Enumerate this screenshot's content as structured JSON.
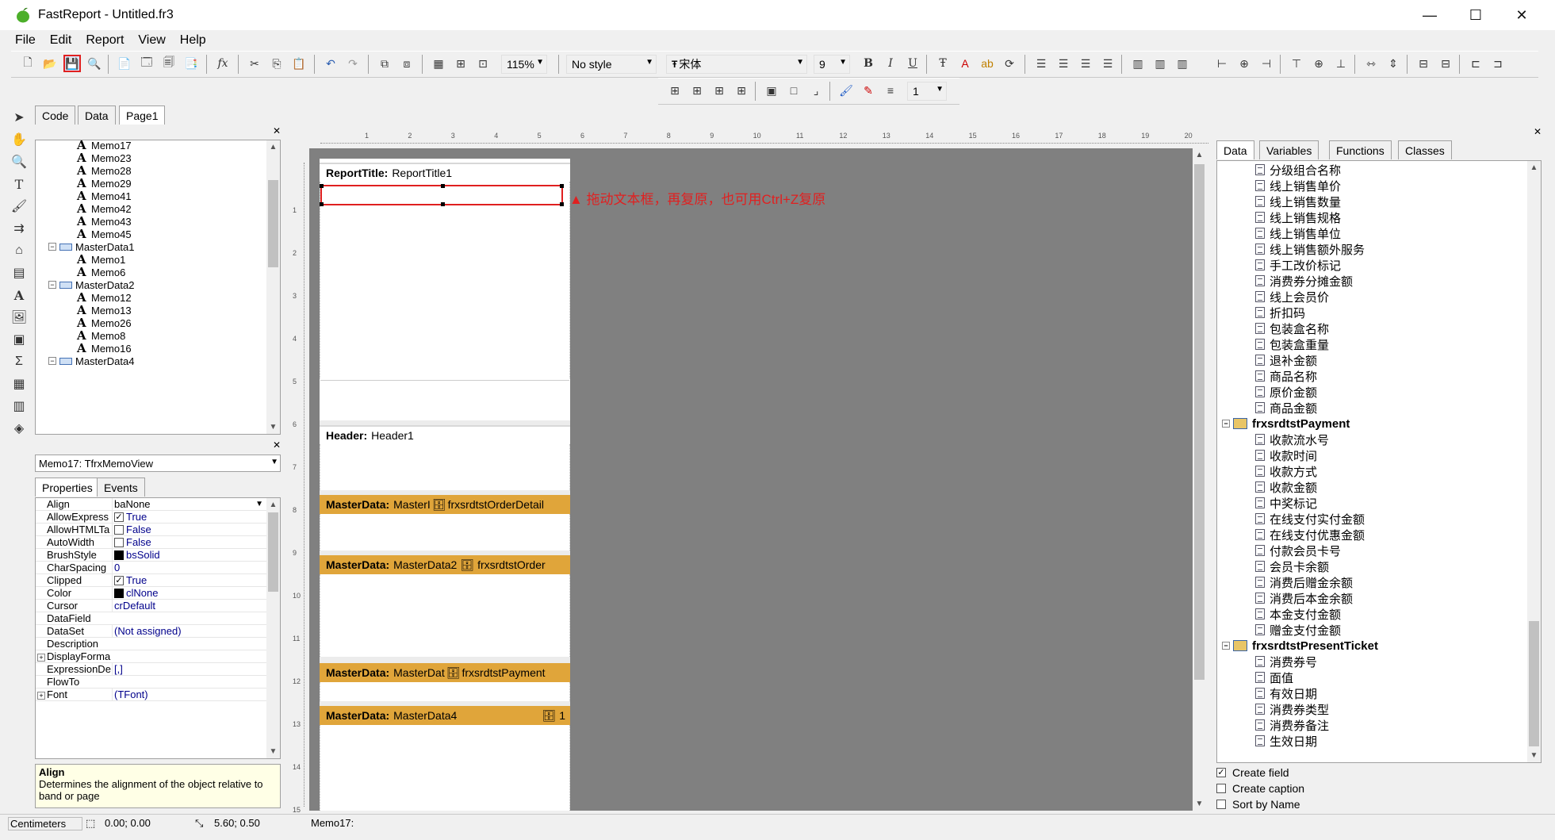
{
  "window": {
    "title": "FastReport - Untitled.fr3",
    "min": "—",
    "max": "☐",
    "close": "✕"
  },
  "menu": [
    "File",
    "Edit",
    "Report",
    "View",
    "Help"
  ],
  "toolbar": {
    "zoom": "115%",
    "style": "No style",
    "font_name": "宋体",
    "font_size": "9",
    "frame_width": "1"
  },
  "designer_tabs": [
    "Code",
    "Data",
    "Page1"
  ],
  "report_tree": [
    {
      "label": "Memo17",
      "kind": "memo",
      "level": 2
    },
    {
      "label": "Memo23",
      "kind": "memo",
      "level": 2
    },
    {
      "label": "Memo28",
      "kind": "memo",
      "level": 2
    },
    {
      "label": "Memo29",
      "kind": "memo",
      "level": 2
    },
    {
      "label": "Memo41",
      "kind": "memo",
      "level": 2
    },
    {
      "label": "Memo42",
      "kind": "memo",
      "level": 2
    },
    {
      "label": "Memo43",
      "kind": "memo",
      "level": 2
    },
    {
      "label": "Memo45",
      "kind": "memo",
      "level": 2
    },
    {
      "label": "MasterData1",
      "kind": "band",
      "level": 1
    },
    {
      "label": "Memo1",
      "kind": "memo",
      "level": 2
    },
    {
      "label": "Memo6",
      "kind": "memo",
      "level": 2
    },
    {
      "label": "MasterData2",
      "kind": "band",
      "level": 1
    },
    {
      "label": "Memo12",
      "kind": "memo",
      "level": 2
    },
    {
      "label": "Memo13",
      "kind": "memo",
      "level": 2
    },
    {
      "label": "Memo26",
      "kind": "memo",
      "level": 2
    },
    {
      "label": "Memo8",
      "kind": "memo",
      "level": 2
    },
    {
      "label": "Memo16",
      "kind": "memo",
      "level": 2
    },
    {
      "label": "MasterData4",
      "kind": "band",
      "level": 1
    }
  ],
  "object_selector": "Memo17: TfrxMemoView",
  "inspector_tabs": [
    "Properties",
    "Events"
  ],
  "properties": [
    {
      "name": "Align",
      "value": "baNone",
      "type": "dropdown"
    },
    {
      "name": "AllowExpress",
      "value": "True",
      "type": "check",
      "checked": true
    },
    {
      "name": "AllowHTMLTa",
      "value": "False",
      "type": "check",
      "checked": false
    },
    {
      "name": "AutoWidth",
      "value": "False",
      "type": "check",
      "checked": false
    },
    {
      "name": "BrushStyle",
      "value": "bsSolid",
      "type": "color"
    },
    {
      "name": "CharSpacing",
      "value": "0",
      "type": "text"
    },
    {
      "name": "Clipped",
      "value": "True",
      "type": "check",
      "checked": true
    },
    {
      "name": "Color",
      "value": "clNone",
      "type": "color"
    },
    {
      "name": "Cursor",
      "value": "crDefault",
      "type": "text"
    },
    {
      "name": "DataField",
      "value": "",
      "type": "text"
    },
    {
      "name": "DataSet",
      "value": "(Not assigned)",
      "type": "text"
    },
    {
      "name": "Description",
      "value": "",
      "type": "text"
    },
    {
      "name": "DisplayForma",
      "value": "",
      "type": "expand"
    },
    {
      "name": "ExpressionDe",
      "value": "[,]",
      "type": "text"
    },
    {
      "name": "FlowTo",
      "value": "",
      "type": "text"
    },
    {
      "name": "Font",
      "value": "(TFont)",
      "type": "expand"
    }
  ],
  "help": {
    "title": "Align",
    "text": "Determines the alignment of the object relative to band or page"
  },
  "bands": [
    {
      "type": "ReportTitle:",
      "name": "ReportTitle1",
      "style": "gray"
    },
    {
      "type": "Header:",
      "name": "Header1",
      "style": "gray"
    },
    {
      "type": "MasterData:",
      "name": "MasterI",
      "ds": "frxsrdtstOrderDetail",
      "style": "orange"
    },
    {
      "type": "MasterData:",
      "name": "MasterData2",
      "ds": "frxsrdtstOrder",
      "style": "orange"
    },
    {
      "type": "MasterData:",
      "name": "MasterDat",
      "ds": "frxsrdtstPayment",
      "style": "orange"
    },
    {
      "type": "MasterData:",
      "name": "MasterData4",
      "ds": "1",
      "style": "orange"
    }
  ],
  "annotation": "拖动文本框，再复原，也可用Ctrl+Z复原",
  "ruler_marks": [
    "1",
    "2",
    "3",
    "4",
    "5",
    "6",
    "7",
    "8",
    "9",
    "10",
    "11",
    "12",
    "13",
    "14",
    "15",
    "16",
    "17",
    "18",
    "19",
    "20"
  ],
  "vruler_marks": [
    "1",
    "2",
    "3",
    "4",
    "5",
    "6",
    "7",
    "8",
    "9",
    "10",
    "11",
    "12",
    "13",
    "14",
    "15"
  ],
  "data_tabs": [
    "Data",
    "Variables",
    "Functions",
    "Classes"
  ],
  "data_tree": [
    {
      "label": "分级组合名称",
      "kind": "field"
    },
    {
      "label": "线上销售单价",
      "kind": "field"
    },
    {
      "label": "线上销售数量",
      "kind": "field"
    },
    {
      "label": "线上销售规格",
      "kind": "field"
    },
    {
      "label": "线上销售单位",
      "kind": "field"
    },
    {
      "label": "线上销售额外服务",
      "kind": "field"
    },
    {
      "label": "手工改价标记",
      "kind": "field"
    },
    {
      "label": "消费券分摊金额",
      "kind": "field"
    },
    {
      "label": "线上会员价",
      "kind": "field"
    },
    {
      "label": "折扣码",
      "kind": "field"
    },
    {
      "label": "包装盒名称",
      "kind": "field"
    },
    {
      "label": "包装盒重量",
      "kind": "field"
    },
    {
      "label": "退补金额",
      "kind": "field"
    },
    {
      "label": "商品名称",
      "kind": "field"
    },
    {
      "label": "原价金额",
      "kind": "field"
    },
    {
      "label": "商品金额",
      "kind": "field"
    },
    {
      "label": "frxsrdtstPayment",
      "kind": "dataset"
    },
    {
      "label": "收款流水号",
      "kind": "field"
    },
    {
      "label": "收款时间",
      "kind": "field"
    },
    {
      "label": "收款方式",
      "kind": "field"
    },
    {
      "label": "收款金额",
      "kind": "field"
    },
    {
      "label": "中奖标记",
      "kind": "field"
    },
    {
      "label": "在线支付实付金额",
      "kind": "field"
    },
    {
      "label": "在线支付优惠金额",
      "kind": "field"
    },
    {
      "label": "付款会员卡号",
      "kind": "field"
    },
    {
      "label": "会员卡余额",
      "kind": "field"
    },
    {
      "label": "消费后赠金余额",
      "kind": "field"
    },
    {
      "label": "消费后本金余额",
      "kind": "field"
    },
    {
      "label": "本金支付金额",
      "kind": "field"
    },
    {
      "label": "赠金支付金额",
      "kind": "field"
    },
    {
      "label": "frxsrdtstPresentTicket",
      "kind": "dataset"
    },
    {
      "label": "消费券号",
      "kind": "field"
    },
    {
      "label": "面值",
      "kind": "field"
    },
    {
      "label": "有效日期",
      "kind": "field"
    },
    {
      "label": "消费券类型",
      "kind": "field"
    },
    {
      "label": "消费券备注",
      "kind": "field"
    },
    {
      "label": "生效日期",
      "kind": "field"
    }
  ],
  "data_options": [
    {
      "label": "Create field",
      "checked": true
    },
    {
      "label": "Create caption",
      "checked": false
    },
    {
      "label": "Sort by Name",
      "checked": false
    }
  ],
  "statusbar": {
    "units": "Centimeters",
    "position": "0.00; 0.00",
    "size": "5.60; 0.50",
    "object": "Memo17:"
  },
  "colors": {
    "band_orange": "#e0a53a",
    "selection_red": "#e02020",
    "workspace_gray": "#808080"
  }
}
